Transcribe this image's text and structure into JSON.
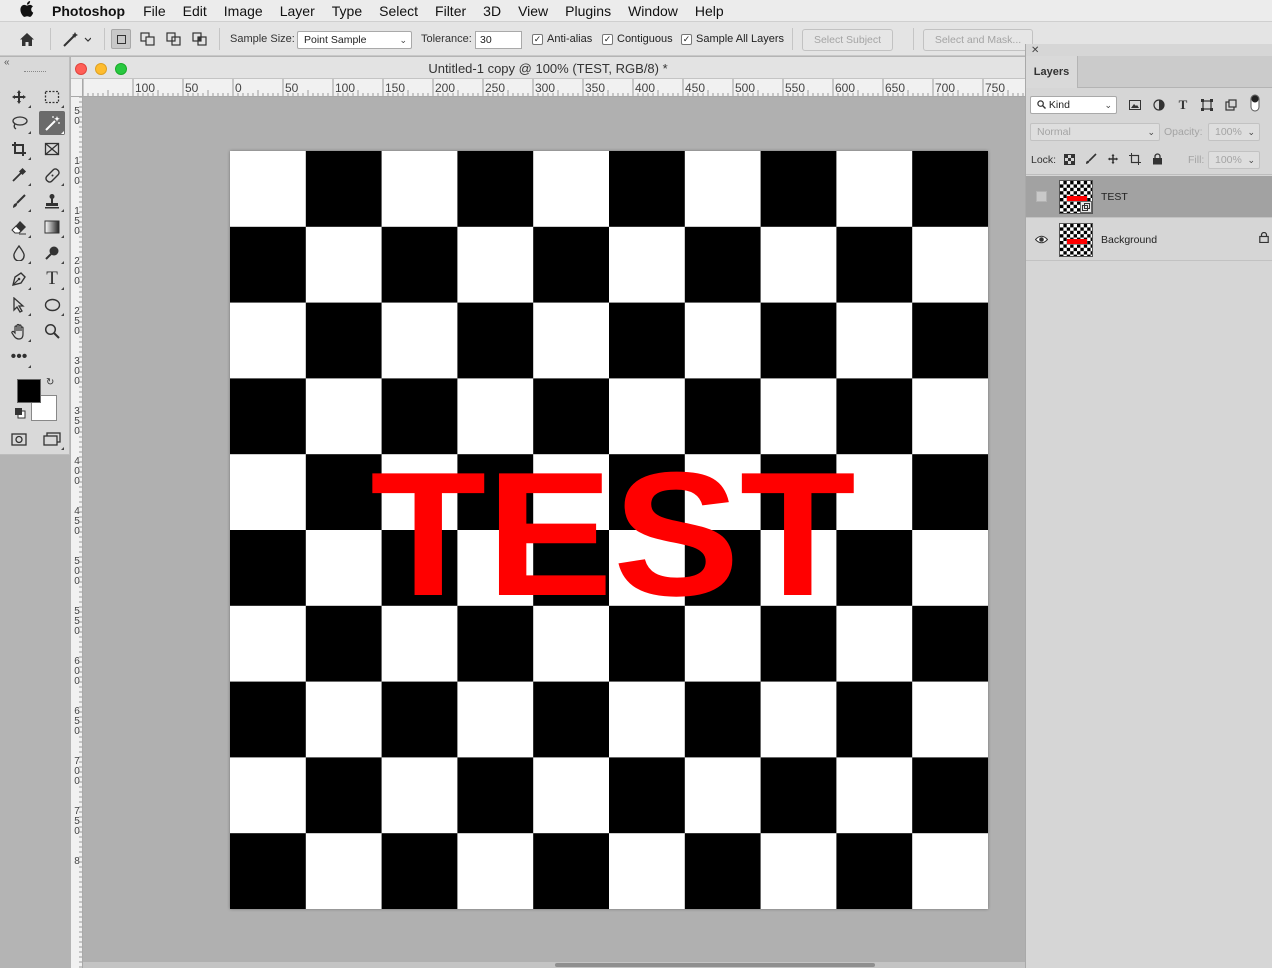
{
  "menubar": {
    "app": "Photoshop",
    "items": [
      "File",
      "Edit",
      "Image",
      "Layer",
      "Type",
      "Select",
      "Filter",
      "3D",
      "View",
      "Plugins",
      "Window",
      "Help"
    ]
  },
  "options": {
    "sample_size_label": "Sample Size:",
    "sample_size_value": "Point Sample",
    "tolerance_label": "Tolerance:",
    "tolerance_value": "30",
    "anti_alias": "Anti-alias",
    "contiguous": "Contiguous",
    "sample_all_layers": "Sample All Layers",
    "select_subject": "Select Subject",
    "select_and_mask": "Select and Mask..."
  },
  "document": {
    "title": "Untitled-1 copy @ 100% (TEST, RGB/8) *",
    "canvas_text": "TEST",
    "text_color": "#ff0000",
    "h_ruler_labels": [
      "100",
      "50",
      "0",
      "50",
      "100",
      "150",
      "200",
      "250",
      "300",
      "350",
      "400",
      "450",
      "500",
      "550",
      "600",
      "650",
      "700",
      "750"
    ],
    "v_ruler_labels": [
      "50",
      "100",
      "150",
      "200",
      "250",
      "300",
      "350",
      "400",
      "450",
      "500",
      "550",
      "600",
      "650",
      "700",
      "750",
      "8"
    ]
  },
  "layers_panel": {
    "tab": "Layers",
    "filter_value": "Kind",
    "blend_mode": "Normal",
    "opacity_label": "Opacity:",
    "opacity_value": "100%",
    "lock_label": "Lock:",
    "fill_label": "Fill:",
    "fill_value": "100%",
    "layers": [
      {
        "name": "TEST",
        "selected": true
      },
      {
        "name": "Background",
        "selected": false,
        "locked": true
      }
    ]
  }
}
